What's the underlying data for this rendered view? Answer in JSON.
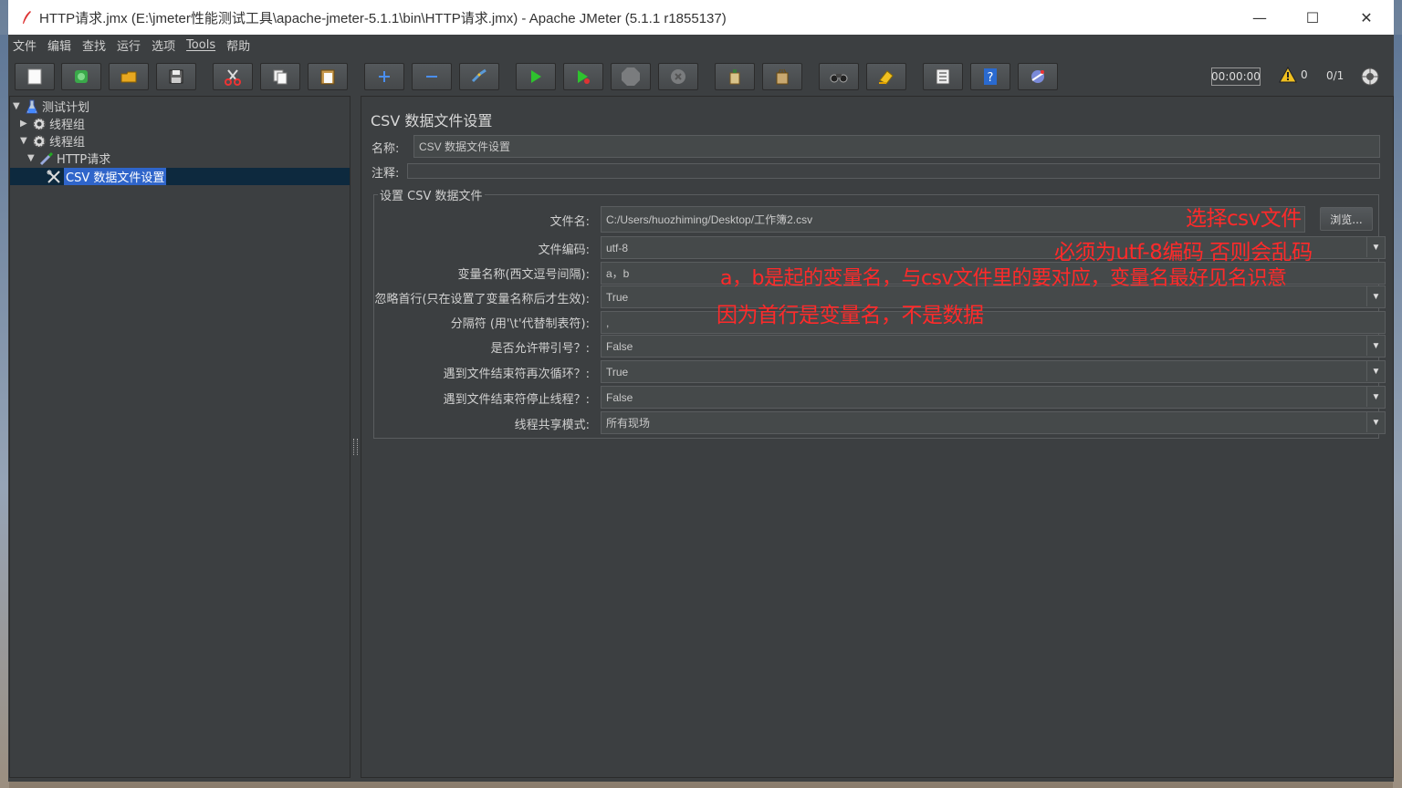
{
  "window": {
    "title": "HTTP请求.jmx (E:\\jmeter性能测试工具\\apache-jmeter-5.1.1\\bin\\HTTP请求.jmx) - Apache JMeter (5.1.1 r1855137)",
    "minimize": "—",
    "maximize": "☐",
    "close": "✕"
  },
  "menu": [
    "文件",
    "编辑",
    "查找",
    "运行",
    "选项",
    "Tools",
    "帮助"
  ],
  "toolbar": {
    "buttons": [
      "new-icon",
      "templates-icon",
      "open-icon",
      "save-icon",
      "cut-icon",
      "copy-icon",
      "paste-icon",
      "expand-icon",
      "collapse-icon",
      "toggle-icon",
      "start-icon",
      "start-no-pause-icon",
      "stop-icon",
      "shutdown-icon",
      "clear-icon",
      "clear-all-icon",
      "search-icon",
      "reset-search-icon",
      "function-helper-icon",
      "help-icon",
      "remote-icon"
    ],
    "elapsed": "00:00:00",
    "warnings": "0",
    "threads": "0/1"
  },
  "tree": {
    "items": [
      {
        "label": "测试计划",
        "icon": "test-plan-icon"
      },
      {
        "label": "线程组",
        "icon": "gear-icon"
      },
      {
        "label": "线程组",
        "icon": "gear-icon"
      },
      {
        "label": "HTTP请求",
        "icon": "sampler-icon"
      },
      {
        "label": "CSV 数据文件设置",
        "icon": "config-tools-icon"
      }
    ]
  },
  "panel": {
    "title": "CSV 数据文件设置",
    "name_label": "名称:",
    "name_value": "CSV 数据文件设置",
    "comment_label": "注释:",
    "comment_value": "",
    "group_title": "设置 CSV 数据文件",
    "browse_label": "浏览...",
    "rows": [
      {
        "label": "文件名:",
        "value": "C:/Users/huozhiming/Desktop/工作簿2.csv"
      },
      {
        "label": "文件编码:",
        "value": "utf-8"
      },
      {
        "label": "变量名称(西文逗号间隔):",
        "value": "a，b"
      },
      {
        "label": "忽略首行(只在设置了变量名称后才生效):",
        "value": "True"
      },
      {
        "label": "分隔符 (用'\\t'代替制表符):",
        "value": ","
      },
      {
        "label": "是否允许带引号？:",
        "value": "False"
      },
      {
        "label": "遇到文件结束符再次循环？:",
        "value": "True"
      },
      {
        "label": "遇到文件结束符停止线程？:",
        "value": "False"
      },
      {
        "label": "线程共享模式:",
        "value": "所有现场"
      }
    ]
  },
  "annotations": [
    "选择csv文件",
    "必须为utf-8编码 否则会乱码",
    "a，b是起的变量名，与csv文件里的要对应，变量名最好见名识意",
    "因为首行是变量名，不是数据"
  ],
  "colors": {
    "background": "#3c3f41",
    "selection": "#2f65ca",
    "annotation": "#ff2a2a"
  }
}
